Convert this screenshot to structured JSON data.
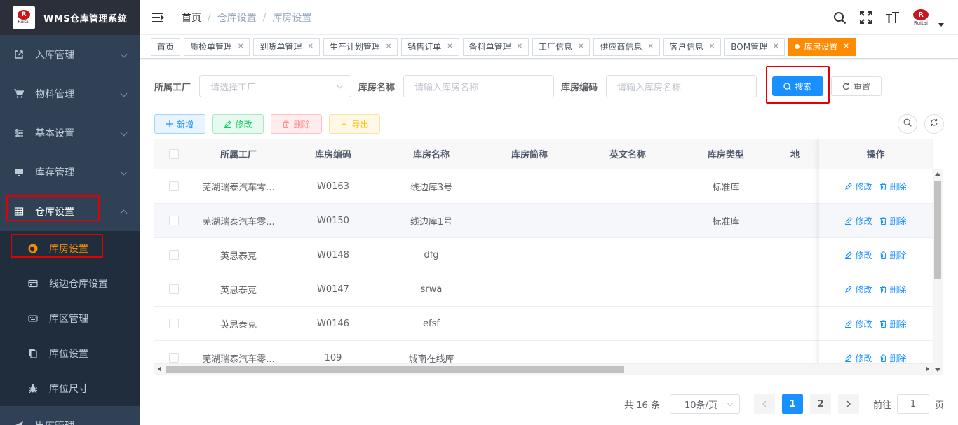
{
  "app": {
    "title": "WMS仓库管理系统",
    "logo_text": "Ruitai",
    "logo_mark": "R"
  },
  "sidebar": {
    "items": [
      {
        "label": "入库管理",
        "icon": "external-link-icon"
      },
      {
        "label": "物料管理",
        "icon": "cart-icon"
      },
      {
        "label": "基本设置",
        "icon": "sliders-icon"
      },
      {
        "label": "库存管理",
        "icon": "monitor-icon"
      },
      {
        "label": "仓库设置",
        "icon": "table-icon",
        "expanded": true
      }
    ],
    "submenu": [
      {
        "label": "库房设置",
        "icon": "github-icon",
        "active": true
      },
      {
        "label": "线边仓库设置",
        "icon": "card-icon"
      },
      {
        "label": "库区管理",
        "icon": "keyboard-icon"
      },
      {
        "label": "库位设置",
        "icon": "documents-icon"
      },
      {
        "label": "库位尺寸",
        "icon": "bug-icon"
      }
    ],
    "after": [
      {
        "label": "出库管理",
        "icon": "send-icon"
      }
    ]
  },
  "breadcrumb": [
    "首页",
    "仓库设置",
    "库房设置"
  ],
  "tags": [
    {
      "label": "首页",
      "closable": false
    },
    {
      "label": "质检单管理",
      "closable": true
    },
    {
      "label": "到货单管理",
      "closable": true
    },
    {
      "label": "生产计划管理",
      "closable": true
    },
    {
      "label": "销售订单",
      "closable": true
    },
    {
      "label": "备料单管理",
      "closable": true
    },
    {
      "label": "工厂信息",
      "closable": true
    },
    {
      "label": "供应商信息",
      "closable": true
    },
    {
      "label": "客户信息",
      "closable": true
    },
    {
      "label": "BOM管理",
      "closable": true
    },
    {
      "label": "库房设置",
      "closable": true,
      "active": true
    }
  ],
  "search": {
    "factory_label": "所属工厂",
    "factory_placeholder": "请选择工厂",
    "name_label": "库房名称",
    "name_placeholder": "请输入库房名称",
    "code_label": "库房编码",
    "code_placeholder": "请输入库房名称",
    "search_button": "搜索",
    "reset_button": "重置"
  },
  "toolbar": {
    "add": "新增",
    "edit": "修改",
    "delete": "删除",
    "export": "导出"
  },
  "table": {
    "columns": [
      "所属工厂",
      "库房编码",
      "库房名称",
      "库房简称",
      "英文名称",
      "库房类型",
      "地",
      "操作"
    ],
    "rows": [
      {
        "factory": "芜湖瑞泰汽车零...",
        "code": "W0163",
        "name": "线边库3号",
        "short": "",
        "en": "",
        "type": "标准库"
      },
      {
        "factory": "芜湖瑞泰汽车零...",
        "code": "W0150",
        "name": "线边库1号",
        "short": "",
        "en": "",
        "type": "标准库"
      },
      {
        "factory": "英思泰克",
        "code": "W0148",
        "name": "dfg",
        "short": "",
        "en": "",
        "type": ""
      },
      {
        "factory": "英思泰克",
        "code": "W0147",
        "name": "srwa",
        "short": "",
        "en": "",
        "type": ""
      },
      {
        "factory": "英思泰克",
        "code": "W0146",
        "name": "efsf",
        "short": "",
        "en": "",
        "type": ""
      },
      {
        "factory": "芜湖瑞泰汽车零...",
        "code": "109",
        "name": "城南在线库",
        "short": "",
        "en": "",
        "type": ""
      }
    ],
    "op_edit": "修改",
    "op_delete": "删除"
  },
  "pagination": {
    "total_text": "共 16 条",
    "page_size": "10条/页",
    "pages": [
      "1",
      "2"
    ],
    "current": "1",
    "goto_label": "前往",
    "goto_value": "1",
    "page_suffix": "页"
  },
  "colors": {
    "sidebar_bg": "#304156",
    "accent": "#ff8c00",
    "primary": "#1890ff",
    "highlight_box": "#e50000"
  }
}
